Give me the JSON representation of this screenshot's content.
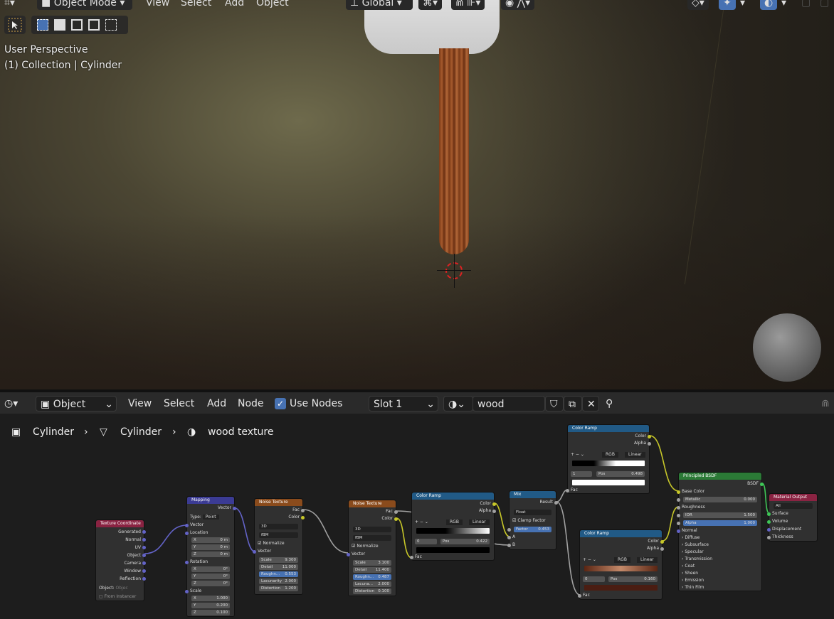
{
  "viewport": {
    "header": {
      "mode": "Object Mode",
      "menus": [
        "View",
        "Select",
        "Add",
        "Object"
      ],
      "orientation": "Global"
    },
    "overlay_text": {
      "perspective": "User Perspective",
      "collection": "(1) Collection | Cylinder"
    }
  },
  "node_editor": {
    "header": {
      "editor_type": "Object",
      "menus": [
        "View",
        "Select",
        "Add",
        "Node"
      ],
      "use_nodes_label": "Use Nodes",
      "slot": "Slot 1",
      "material_name": "wood texture"
    },
    "breadcrumb": [
      "Cylinder",
      "Cylinder",
      "wood texture"
    ],
    "nodes": {
      "texture_coordinate": {
        "title": "Texture Coordinate",
        "outputs": [
          "Generated",
          "Normal",
          "UV",
          "Object",
          "Camera",
          "Window",
          "Reflection"
        ],
        "object_label": "Object:",
        "object_placeholder": "Objec",
        "from_instancer": "From Instancer"
      },
      "mapping": {
        "title": "Mapping",
        "output": "Vector",
        "type_label": "Type:",
        "type_value": "Point",
        "vector": "Vector",
        "location": "Location",
        "loc": [
          [
            "X",
            "0 m"
          ],
          [
            "Y",
            "0 m"
          ],
          [
            "Z",
            "0 m"
          ]
        ],
        "rotation": "Rotation",
        "rot": [
          [
            "X",
            "0°"
          ],
          [
            "Y",
            "0°"
          ],
          [
            "Z",
            "0°"
          ]
        ],
        "scale": "Scale",
        "scl": [
          [
            "X",
            "1.000"
          ],
          [
            "Y",
            "0.200"
          ],
          [
            "Z",
            "0.100"
          ]
        ]
      },
      "noise1": {
        "title": "Noise Texture",
        "outputs": [
          "Fac",
          "Color"
        ],
        "dim": "3D",
        "kind": "fBM",
        "normalize": "Normalize",
        "vector": "Vector",
        "fields": [
          [
            "Scale",
            "9.300"
          ],
          [
            "Detail",
            "11.000"
          ],
          [
            "Roughn...",
            "0.553"
          ],
          [
            "Lacunarity",
            "2.000"
          ],
          [
            "Distortion",
            "1.200"
          ]
        ]
      },
      "noise2": {
        "title": "Noise Texture",
        "outputs": [
          "Fac",
          "Color"
        ],
        "dim": "3D",
        "kind": "fBM",
        "normalize": "Normalize",
        "vector": "Vector",
        "fields": [
          [
            "Scale",
            "3.100"
          ],
          [
            "Detail",
            "11.400"
          ],
          [
            "Roughn...",
            "0.487"
          ],
          [
            "Lacuna...",
            "2.000"
          ],
          [
            "Distortion",
            "0.100"
          ]
        ]
      },
      "ramp1": {
        "title": "Color Ramp",
        "outputs": [
          "Color",
          "Alpha"
        ],
        "mode": "RGB",
        "interp": "Linear",
        "index": "0",
        "pos_label": "Pos",
        "pos": "0.422",
        "input": "Fac"
      },
      "mix": {
        "title": "Mix",
        "output": "Result",
        "type": "Float",
        "clamp": "Clamp Factor",
        "factor_label": "Factor",
        "factor": "0.453",
        "a": "A",
        "b": "B"
      },
      "ramp2": {
        "title": "Color Ramp",
        "outputs": [
          "Color",
          "Alpha"
        ],
        "mode": "RGB",
        "interp": "Linear",
        "index": "1",
        "pos_label": "Pos",
        "pos": "0.498",
        "input": "Fac"
      },
      "ramp3": {
        "title": "Color Ramp",
        "outputs": [
          "Color",
          "Alpha"
        ],
        "mode": "RGB",
        "interp": "Linear",
        "index": "0",
        "pos_label": "Pos",
        "pos": "0.160",
        "input": "Fac"
      },
      "bsdf": {
        "title": "Principled BSDF",
        "output": "BSDF",
        "base_color": "Base Color",
        "fields": [
          [
            "Metallic",
            "0.000"
          ],
          [
            "Roughness",
            ""
          ],
          [
            "IOR",
            "1.500"
          ],
          [
            "Alpha",
            "1.000"
          ]
        ],
        "normal": "Normal",
        "panels": [
          "Diffuse",
          "Subsurface",
          "Specular",
          "Transmission",
          "Coat",
          "Sheen",
          "Emission",
          "Thin Film"
        ]
      },
      "output": {
        "title": "Material Output",
        "target": "All",
        "inputs": [
          "Surface",
          "Volume",
          "Displacement",
          "Thickness"
        ]
      }
    }
  },
  "colors": {
    "accent": "#4772b3",
    "header_texcoord": "#8a2342",
    "header_mapping": "#3b3b94",
    "header_texture": "#8a4b1c",
    "header_converter": "#215a86",
    "header_shader": "#2b7a36",
    "header_output": "#8a2342",
    "socket_vector": "#6363c7",
    "socket_color": "#c7c729",
    "socket_float": "#a1a1a1",
    "socket_shader": "#3fc757"
  }
}
